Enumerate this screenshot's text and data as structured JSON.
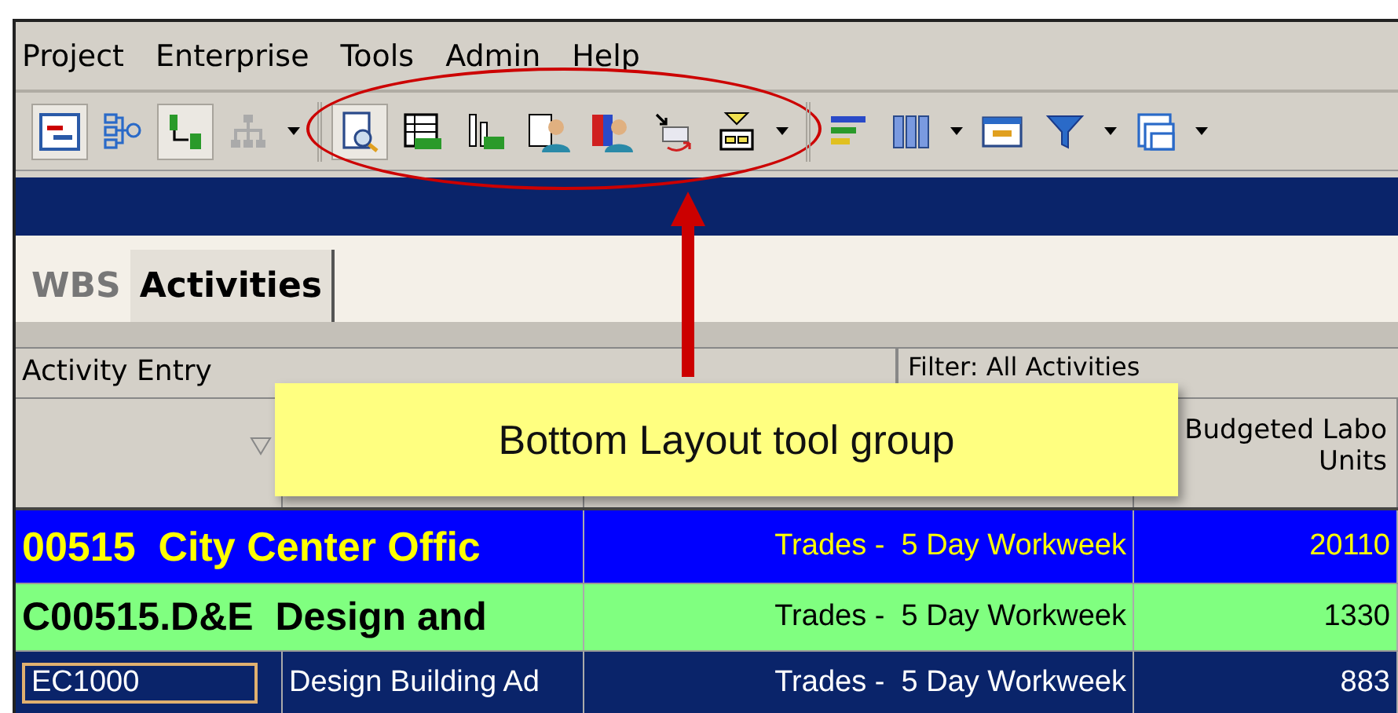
{
  "menu": [
    "Project",
    "Enterprise",
    "Tools",
    "Admin",
    "Help"
  ],
  "toolbar_groups": [
    {
      "circled": false,
      "items": [
        {
          "kind": "gantt",
          "pressed": true
        },
        {
          "kind": "tree",
          "pressed": false
        },
        {
          "kind": "flow",
          "pressed": true
        },
        {
          "kind": "org",
          "pressed": false
        },
        {
          "kind": "caret",
          "pressed": false
        }
      ]
    },
    {
      "circled": true,
      "items": [
        {
          "kind": "layout",
          "pressed": true
        },
        {
          "kind": "table",
          "pressed": false
        },
        {
          "kind": "bars",
          "pressed": false
        },
        {
          "kind": "person-table",
          "pressed": false
        },
        {
          "kind": "person-red",
          "pressed": false
        },
        {
          "kind": "move",
          "pressed": false
        },
        {
          "kind": "filter-box",
          "pressed": false
        },
        {
          "kind": "caret",
          "pressed": false
        }
      ]
    },
    {
      "circled": false,
      "items": [
        {
          "kind": "bars-color",
          "pressed": false
        },
        {
          "kind": "columns",
          "pressed": false
        },
        {
          "kind": "caret",
          "pressed": false
        },
        {
          "kind": "grid",
          "pressed": false
        },
        {
          "kind": "funnel",
          "pressed": false
        },
        {
          "kind": "caret",
          "pressed": false
        },
        {
          "kind": "layers",
          "pressed": false
        },
        {
          "kind": "caret",
          "pressed": false
        }
      ]
    }
  ],
  "tabs": [
    {
      "label": "WBS",
      "selected": false
    },
    {
      "label": "Activities",
      "selected": true
    }
  ],
  "panel_title": "Activity Entry",
  "filter": "Filter: All Activities",
  "columns": [
    {
      "sort": true
    },
    {
      "sort": false
    },
    {
      "sort": false
    },
    {
      "label": "Budgeted Labo\nUnits",
      "sort": false
    }
  ],
  "rows": [
    {
      "kind": "project",
      "cells": [
        "00515  City Center Offic",
        "",
        "Trades -  5 Day Workweek",
        "20110"
      ]
    },
    {
      "kind": "wbs",
      "cells": [
        "C00515.D&E  Design and",
        "",
        "Trades -  5 Day Workweek",
        "1330"
      ]
    },
    {
      "kind": "activity",
      "cells": [
        "EC1000",
        "Design Building Ad",
        "Trades -  5 Day Workweek",
        "883"
      ]
    }
  ],
  "callout": "Bottom Layout tool group"
}
